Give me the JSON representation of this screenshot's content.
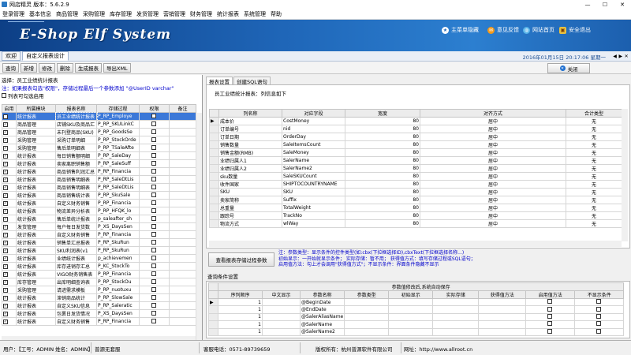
{
  "window": {
    "title": "网店精灵  版本：5.6.2.9",
    "controls": [
      "—",
      "☐",
      "✕"
    ]
  },
  "menu": [
    "登录管理",
    "基本信息",
    "商品管理",
    "采购管理",
    "库存管理",
    "发货管理",
    "营销管理",
    "财务管理",
    "统计报表",
    "系统管理",
    "帮助"
  ],
  "banner": {
    "logo": "E-Shop Elf System",
    "buttons": [
      "主菜单隐藏",
      "意见反馈",
      "网站首页",
      "安全退出"
    ],
    "datetime": "2016年01月15日 20:17:06 星期一"
  },
  "tabs": [
    "欢迎",
    "自定义报表设计"
  ],
  "actions": [
    "查询",
    "新增",
    "修改",
    "删除",
    "生成报表",
    "导出XML"
  ],
  "close_label": "关闭",
  "left": {
    "label": "选择：员工业绩统计报表",
    "hint": "注：如果报表勾选\"权限\"，存储过程最后一个参数添加 \"@UserID varchar\"",
    "list_mode": "列表可勾选启用",
    "headers": [
      "启用",
      "所属模块",
      "报表名称",
      "存储过程",
      "权限",
      "备注"
    ],
    "rows": [
      [
        "统计报表",
        "员工业绩统计报表",
        "P_RP_Employe"
      ],
      [
        "商品管理",
        "店铺SKU及商品汇",
        "P_RP_SKULinkC"
      ],
      [
        "商品管理",
        "未刊登商品(SKU)",
        "P_RP_GoodsSe"
      ],
      [
        "采购管理",
        "采购订单明细",
        "P_RP_StockOrde"
      ],
      [
        "采购管理",
        "售后单明细表",
        "P_RP_TSaleAfte"
      ],
      [
        "统计报表",
        "每日销售额明细",
        "P_RP_SaleDay"
      ],
      [
        "统计报表",
        "卖家离职销售额",
        "P_RP_SaleSuff"
      ],
      [
        "统计报表",
        "商品销售利润汇总",
        "P_RP_Financia"
      ],
      [
        "统计报表",
        "商品销售明细表",
        "P_RP_SaleDtLis"
      ],
      [
        "统计报表",
        "商品销售明细表",
        "P_RP_SaleDtLis"
      ],
      [
        "统计报表",
        "商品销售统计表",
        "P_RP_SkuSale"
      ],
      [
        "统计报表",
        "自定义财务销售",
        "P_RP_Financia"
      ],
      [
        "统计报表",
        "物流差异分析表",
        "P_RP_HFQK_lo"
      ],
      [
        "统计报表",
        "售后单统计报表",
        "p_saleafter_sh"
      ],
      [
        "发货管理",
        "每户每日发货数",
        "P_XS_DaysSen"
      ],
      [
        "统计报表",
        "自定义财务销售",
        "P_RP_Financia"
      ],
      [
        "统计报表",
        "销售单汇总报表",
        "P_RP_SkuRun"
      ],
      [
        "统计报表",
        "SKU利润表(v1",
        "P_RP_SkuRun"
      ],
      [
        "统计报表",
        "业绩统计报表",
        "p_achievemen"
      ],
      [
        "统计报表",
        "库存进销存汇总",
        "P_KC_StockTo"
      ],
      [
        "统计报表",
        "VIGO财务销售表",
        "P_RP_Financia"
      ],
      [
        "库存管理",
        "出库明细查询表",
        "P_RP_StockOu"
      ],
      [
        "采购管理",
        "请进需求模板",
        "P_RP_nuotuxu"
      ],
      [
        "统计报表",
        "滞销商品统计",
        "P_RP_SlowSale"
      ],
      [
        "统计报表",
        "自定义SKU信息",
        "P_RP_Saleratic"
      ],
      [
        "统计报表",
        "包裹日发货情况",
        "P_XS_DaysSen"
      ],
      [
        "统计报表",
        "自定义财务销售",
        "P_RP_Financia"
      ]
    ]
  },
  "right": {
    "tabs": [
      "报表设置",
      "创建SQL语句"
    ],
    "title": "员工业绩统计报表：列信息如下",
    "headers": [
      "列名称",
      "对应字段",
      "宽度",
      "对齐方式",
      "合计类型"
    ],
    "rows": [
      [
        "成本价",
        "CostMoney",
        "80",
        "居中",
        "无"
      ],
      [
        "订单编号",
        "nid",
        "80",
        "居中",
        "无"
      ],
      [
        "订单日期",
        "OrderDay",
        "80",
        "居中",
        "无"
      ],
      [
        "销售数量",
        "SaleItemsCount",
        "80",
        "居中",
        "无"
      ],
      [
        "销售金额(RMB)",
        "SaleMoney",
        "80",
        "居中",
        "无"
      ],
      [
        "业绩归属人1",
        "SalerName",
        "80",
        "居中",
        "无"
      ],
      [
        "业绩归属人2",
        "SalerName2",
        "80",
        "居中",
        "无"
      ],
      [
        "sku数量",
        "SaleSKUCount",
        "80",
        "居中",
        "无"
      ],
      [
        "收件国家",
        "SHIPTOCOUNTRYNAME",
        "80",
        "居中",
        "无"
      ],
      [
        "SKU",
        "SKU",
        "80",
        "居中",
        "无"
      ],
      [
        "卖家简称",
        "Suffix",
        "80",
        "居中",
        "无"
      ],
      [
        "总重量",
        "TotalWeight",
        "80",
        "居中",
        "无"
      ],
      [
        "跟踪号",
        "TrackNo",
        "80",
        "居中",
        "无"
      ],
      [
        "物流方式",
        "wlWay",
        "80",
        "居中",
        "无"
      ]
    ],
    "view_button": "查看报表存储过程参数",
    "notes": [
      "注：参数类型：显示条件的控件类型(如:cbx(下拉框选择ID),cbxText(下拉框选择名称...)",
      "初始显示：一开始就显示条件； 实际存储：暂不用； 获得值方式：填写存储过程或SQL语句；",
      "启用值方法：勾上才会调用\"获得值方式\"；不显示条件：界面条件隐藏不显示"
    ],
    "query_title": "查询条件设置",
    "query_group": "参数值修改后,系统自动保存",
    "query_headers": [
      "序列顺序",
      "中文显示",
      "参数名称",
      "参数类型",
      "初始显示",
      "实际存储",
      "获得值方法",
      "启用值方法",
      "不显示条件"
    ],
    "query_rows": [
      [
        "1",
        "",
        "@BeginDate"
      ],
      [
        "1",
        "",
        "@EndDate"
      ],
      [
        "1",
        "",
        "@SalerAliasName"
      ],
      [
        "1",
        "",
        "@SalerName"
      ],
      [
        "1",
        "",
        "@SalerName2"
      ]
    ]
  },
  "status": {
    "user": "用户：【工号：ADMIN  姓名：ADMIN】",
    "company": "普源无套服",
    "phone": "客服电话：0571-89739659",
    "rights": "版权所有：杭州普源软件有限公司",
    "site": "网址：http://www.allroot.cn"
  }
}
